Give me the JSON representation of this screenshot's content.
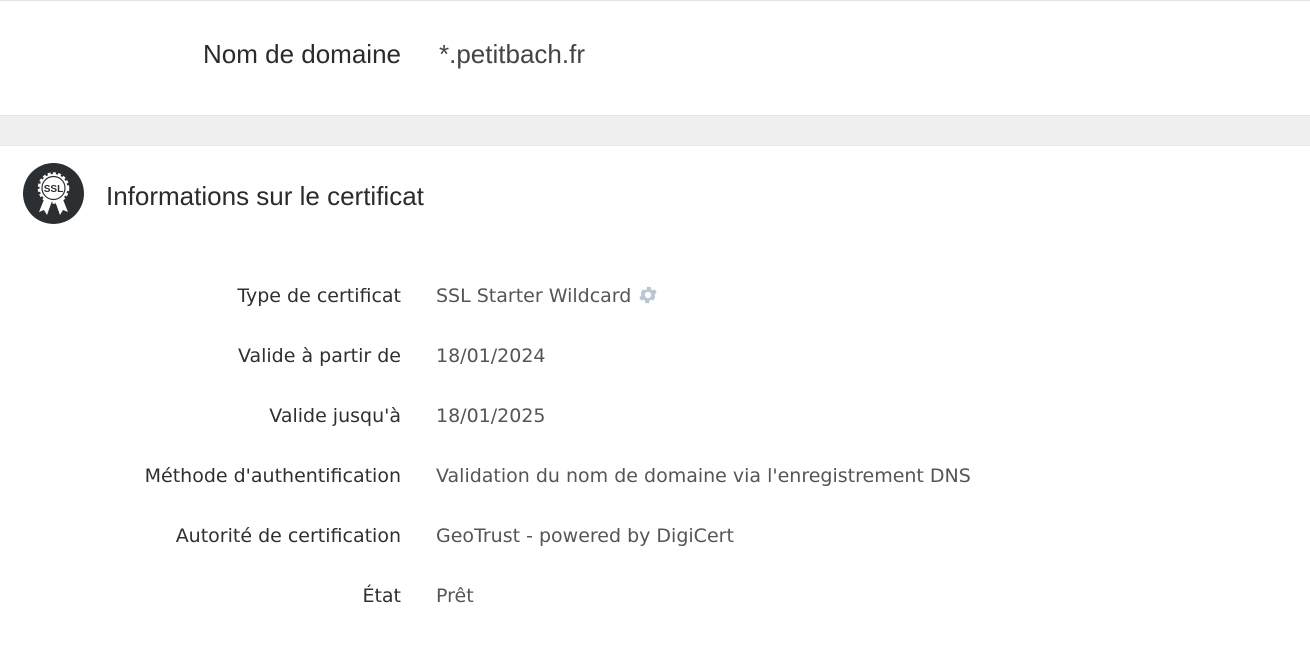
{
  "domain": {
    "label": "Nom de domaine",
    "value": "*.petitbach.fr"
  },
  "certificate": {
    "title": "Informations sur le certificat",
    "badge_text": "SSL",
    "rows": [
      {
        "label": "Type de certificat",
        "value": "SSL Starter Wildcard",
        "icon": "gear-icon"
      },
      {
        "label": "Valide à partir de",
        "value": "18/01/2024"
      },
      {
        "label": "Valide jusqu'à",
        "value": "18/01/2025"
      },
      {
        "label": "Méthode d'authentification",
        "value": "Validation du nom de domaine via l'enregistrement DNS"
      },
      {
        "label": "Autorité de certification",
        "value": "GeoTrust - powered by DigiCert"
      },
      {
        "label": "État",
        "value": "Prêt"
      }
    ]
  },
  "colors": {
    "badge_bg": "#2c2f31",
    "gear": "#b9c6d3",
    "band": "#efefef"
  }
}
